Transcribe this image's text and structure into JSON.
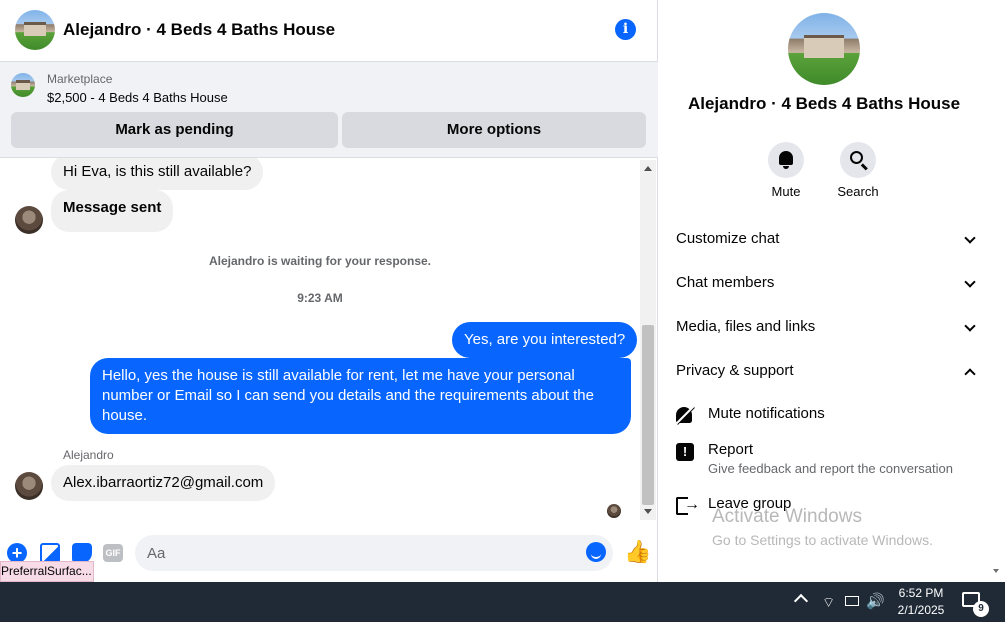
{
  "header": {
    "title": "Alejandro · 4 Beds 4 Baths House",
    "info_icon": "i"
  },
  "marketplace": {
    "label": "Marketplace",
    "listing": "$2,500 - 4 Beds 4 Baths House",
    "mark_pending": "Mark as pending",
    "more_options": "More options"
  },
  "messages": {
    "m1": "Hi Eva, is this still available?",
    "m2": "Message sent",
    "waiting": "Alejandro is waiting for your response.",
    "time": "9:23 AM",
    "m3": "Yes, are you interested?",
    "m4": "Hello, yes the house is still available for rent, let me have your personal number or Email so I can send you details and the requirements about the house.",
    "sender": "Alejandro",
    "m5": "Alex.ibarraortiz72@gmail.com"
  },
  "composer": {
    "placeholder": "Aa",
    "gif": "GIF",
    "plus": "+"
  },
  "tooltip": "PreferralSurfac...",
  "info": {
    "title": "Alejandro · 4 Beds 4 Baths House",
    "mute": "Mute",
    "search": "Search",
    "sections": {
      "customize": "Customize chat",
      "members": "Chat members",
      "media": "Media, files and links",
      "privacy": "Privacy & support"
    },
    "mute_notifications": "Mute notifications",
    "report": "Report",
    "report_desc": "Give feedback and report the conversation",
    "leave": "Leave group"
  },
  "watermark": {
    "title": "Activate Windows",
    "subtitle": "Go to Settings to activate Windows."
  },
  "taskbar": {
    "time": "6:52 PM",
    "date": "2/1/2025",
    "notifications": "9"
  }
}
